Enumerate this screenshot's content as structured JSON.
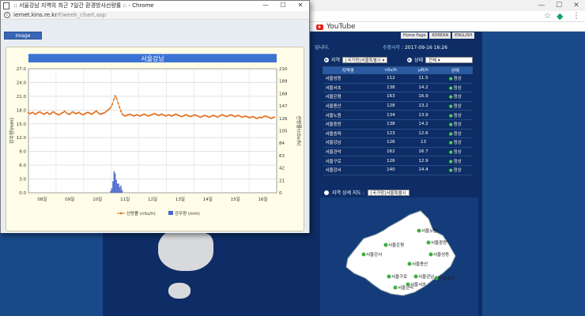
{
  "browser": {
    "bookmark_youtube": "YouTube",
    "win_min": "—",
    "win_max": "☐",
    "win_close": "✕",
    "star": "☆",
    "menu": "⋮"
  },
  "popup": {
    "window_title": ":: 서울강남 지역의 최근 7일간 환경방사선량률 :: - Chrome",
    "url_host": "iernet.kins.re.kr",
    "url_path": "/f/week_chart.asp",
    "image_tab": "Image",
    "chart_title": "서울강남"
  },
  "site": {
    "header_left": "입니다.",
    "update_label": "수정시각 :",
    "update_time": "2017-09-16 16:26",
    "btn_home": "Home Page",
    "btn_lang": "KOREAN",
    "btn_eng": "ENGLISH",
    "region_label": "지역",
    "region_value": "[국가망]서울특별시",
    "status_label": "상태",
    "status_value": "전체",
    "map_title": "지역 상세 지도 :",
    "map_region": "[국가망]서울특별시"
  },
  "table": {
    "headers": [
      "지역명",
      "nSv/h",
      "μR/h",
      "상태"
    ],
    "rows": [
      [
        "서울성동",
        "112",
        "11.5",
        "정상"
      ],
      [
        "서울서초",
        "138",
        "14.2",
        "정상"
      ],
      [
        "서울은평",
        "163",
        "16.9",
        "정상"
      ],
      [
        "서울용산",
        "128",
        "13.2",
        "정상"
      ],
      [
        "서울노원",
        "134",
        "13.9",
        "정상"
      ],
      [
        "서울중랑",
        "138",
        "14.2",
        "정상"
      ],
      [
        "서울송파",
        "123",
        "12.6",
        "정상"
      ],
      [
        "서울강남",
        "126",
        "13",
        "정상"
      ],
      [
        "서울관악",
        "162",
        "16.7",
        "정상"
      ],
      [
        "서울구로",
        "126",
        "12.9",
        "정상"
      ],
      [
        "서울강서",
        "140",
        "14.4",
        "정상"
      ]
    ]
  },
  "map_labels": [
    "서울노원",
    "서울중랑",
    "서울은평",
    "서울강서",
    "서울용산",
    "서울성동",
    "서울구로",
    "서울관악",
    "서울강남",
    "서울서초",
    "서울송파"
  ],
  "chart_data": {
    "type": "line",
    "title": "서울강남",
    "ylabel_left": "강우량(mm)",
    "ylabel_right": "선량률(nSv/h)",
    "categories": [
      "08일",
      "09일",
      "10일",
      "11일",
      "12일",
      "13일",
      "14일",
      "15일"
    ],
    "categories_extra": "16일",
    "left_ticks": [
      "0.0",
      "3.0",
      "6.0",
      "9.0",
      "12.0",
      "15.0",
      "18.0",
      "21.0",
      "24.0",
      "27.0"
    ],
    "right_ticks": [
      "0",
      "21",
      "42",
      "63",
      "84",
      "105",
      "126",
      "147",
      "168",
      "189",
      "210"
    ],
    "ylim_left": [
      0,
      27
    ],
    "ylim_right": [
      0,
      210
    ],
    "legend": [
      "선량률 (nSv/h)",
      "강우량 (mm)"
    ],
    "series": [
      {
        "name": "선량률 (nSv/h)",
        "axis": "right",
        "color": "#e07020",
        "values": [
          136,
          134,
          135,
          136,
          134,
          133,
          135,
          136,
          137,
          135,
          134,
          133,
          135,
          136,
          134,
          133,
          135,
          137,
          136,
          134,
          133,
          132,
          133,
          135,
          136,
          138,
          136,
          134,
          133,
          134,
          136,
          137,
          135,
          134,
          135,
          136,
          134,
          133,
          132,
          134,
          135,
          136,
          135,
          134,
          133,
          135,
          137,
          138,
          136,
          134,
          133,
          134,
          135,
          136,
          138,
          140,
          142,
          145,
          150,
          158,
          164,
          160,
          152,
          145,
          138,
          133,
          131,
          130,
          131,
          132,
          133,
          132,
          131,
          130,
          131,
          132,
          131,
          130,
          131,
          132,
          133,
          132,
          131,
          130,
          131,
          132,
          133,
          134,
          133,
          132,
          131,
          132,
          133,
          132,
          131,
          130,
          131,
          132,
          131,
          130,
          131,
          132,
          133,
          132,
          131,
          130,
          129,
          130,
          131,
          132,
          131,
          130,
          129,
          130,
          131,
          132,
          131,
          130,
          129,
          128,
          129,
          130,
          131,
          130,
          129,
          128,
          129,
          130,
          131,
          130,
          129,
          128,
          130,
          131,
          132,
          131,
          130,
          129,
          130,
          131,
          132,
          131,
          130,
          129,
          130,
          131,
          130,
          129,
          128,
          129,
          130,
          129,
          128,
          127,
          128,
          129,
          128,
          127,
          126,
          127,
          128,
          127,
          128,
          129,
          130,
          129,
          128,
          127,
          126,
          127,
          128
        ]
      },
      {
        "name": "강우량 (mm)",
        "axis": "left",
        "color": "#4466cc",
        "start_day": 2.96,
        "values": [
          0.4,
          1.0,
          2.5,
          4.7,
          4.2,
          2.8,
          2.0,
          2.0,
          1.2,
          1.6,
          0.6
        ]
      }
    ]
  }
}
